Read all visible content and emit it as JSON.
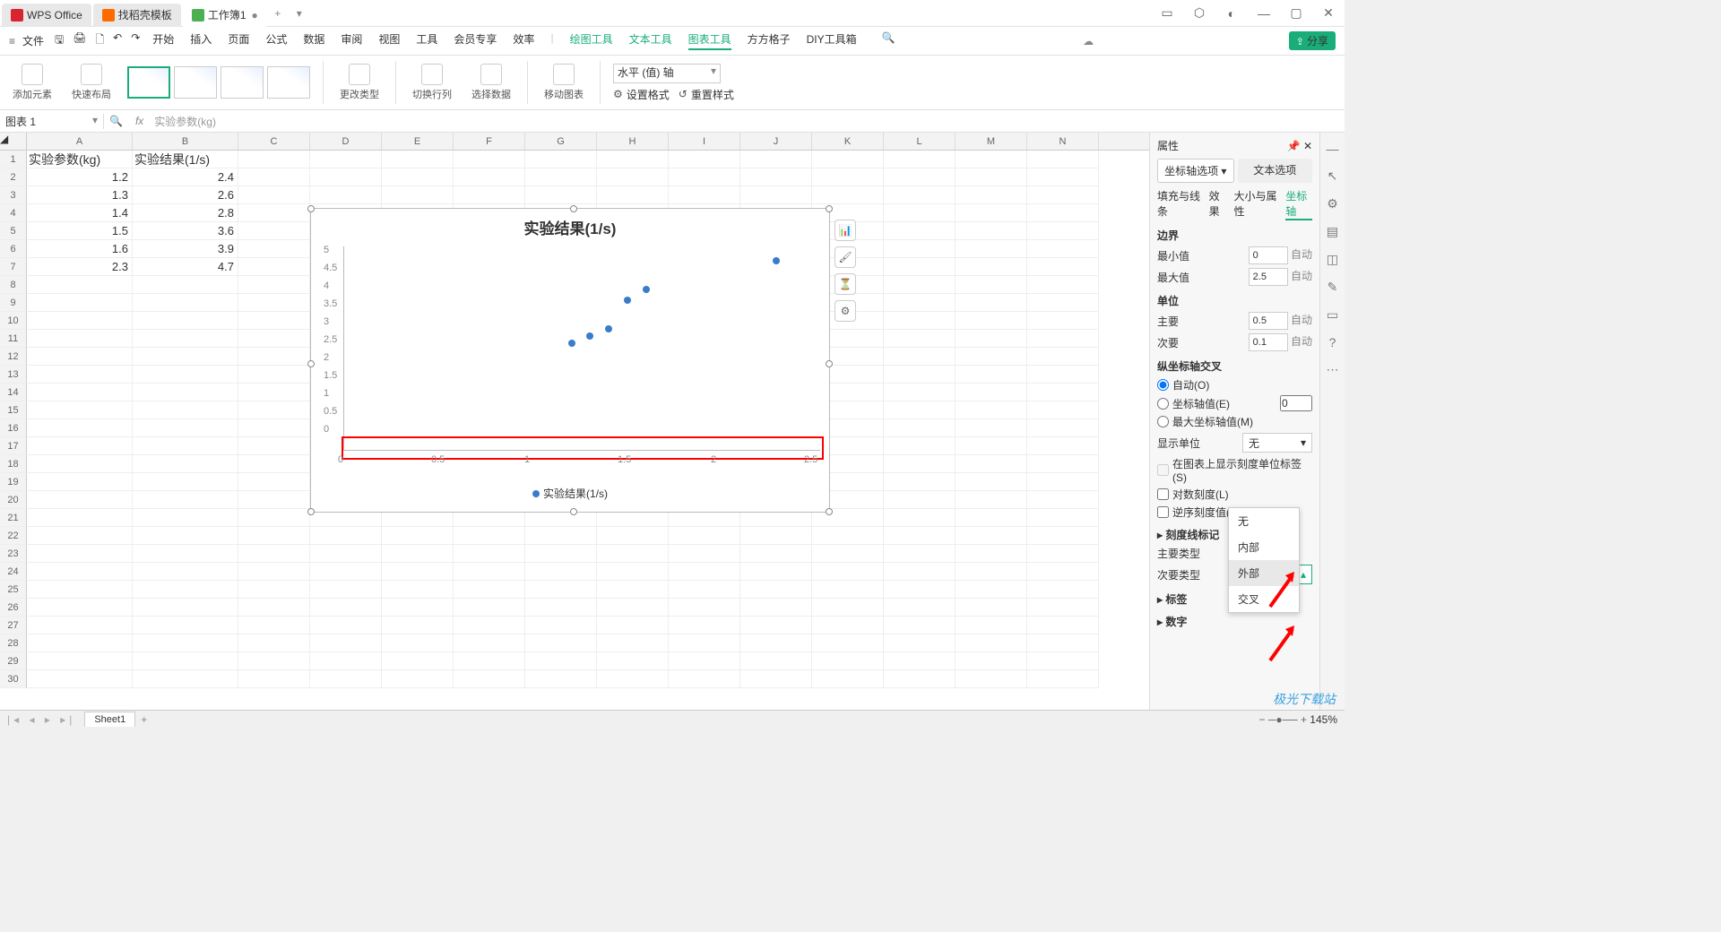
{
  "title_tabs": [
    {
      "icon": "wps",
      "label": "WPS Office"
    },
    {
      "icon": "orange",
      "label": "找稻壳模板"
    },
    {
      "icon": "green",
      "label": "工作簿1",
      "active": true
    }
  ],
  "menu": {
    "file": "文件",
    "tabs": [
      "开始",
      "插入",
      "页面",
      "公式",
      "数据",
      "审阅",
      "视图",
      "工具",
      "会员专享",
      "效率"
    ],
    "green_tabs": [
      "绘图工具",
      "文本工具",
      "图表工具",
      "方方格子",
      "DIY工具箱"
    ],
    "active": "图表工具",
    "share": "分享"
  },
  "toolbar": {
    "add_element": "添加元素",
    "quick_layout": "快速布局",
    "change_type": "更改类型",
    "switch_rc": "切换行列",
    "select_data": "选择数据",
    "move_chart": "移动图表",
    "axis_select": "水平 (值) 轴",
    "set_format": "设置格式",
    "reset_style": "重置样式"
  },
  "fx": {
    "name": "图表 1",
    "formula": "实验参数(kg)"
  },
  "columns": [
    "A",
    "B",
    "C",
    "D",
    "E",
    "F",
    "G",
    "H",
    "I",
    "J",
    "K",
    "L",
    "M",
    "N"
  ],
  "sheet_data": {
    "headers": [
      "实验参数(kg)",
      "实验结果(1/s)"
    ],
    "rows": [
      [
        1.2,
        2.4
      ],
      [
        1.3,
        2.6
      ],
      [
        1.4,
        2.8
      ],
      [
        1.5,
        3.6
      ],
      [
        1.6,
        3.9
      ],
      [
        2.3,
        4.7
      ]
    ]
  },
  "chart_data": {
    "type": "scatter",
    "title": "实验结果(1/s)",
    "x": [
      1.2,
      1.3,
      1.4,
      1.5,
      1.6,
      2.3
    ],
    "y": [
      2.4,
      2.6,
      2.8,
      3.6,
      3.9,
      4.7
    ],
    "series": [
      {
        "name": "实验结果(1/s)",
        "x": [
          1.2,
          1.3,
          1.4,
          1.5,
          1.6,
          2.3
        ],
        "y": [
          2.4,
          2.6,
          2.8,
          3.6,
          3.9,
          4.7
        ]
      }
    ],
    "xlim": [
      0,
      2.5
    ],
    "ylim": [
      0,
      5
    ],
    "x_major": 0.5,
    "y_major": 0.5,
    "legend": "实验结果(1/s)"
  },
  "prop": {
    "title": "属性",
    "tab1": "坐标轴选项",
    "tab2": "文本选项",
    "sub": [
      "填充与线条",
      "效果",
      "大小与属性",
      "坐标轴"
    ],
    "boundary": "边界",
    "min": "最小值",
    "min_val": "0",
    "max": "最大值",
    "max_val": "2.5",
    "auto": "自动",
    "unit": "单位",
    "major": "主要",
    "major_val": "0.5",
    "minor": "次要",
    "minor_val": "0.1",
    "cross": "纵坐标轴交叉",
    "auto_o": "自动(O)",
    "axis_e": "坐标轴值(E)",
    "axis_e_val": "0",
    "max_m": "最大坐标轴值(M)",
    "disp_unit": "显示单位",
    "none": "无",
    "show_label": "在图表上显示刻度单位标签(S)",
    "log": "对数刻度(L)",
    "rev": "逆序刻度值(V)",
    "ticks": "刻度线标记",
    "major_type": "主要类型",
    "minor_type": "次要类型",
    "minor_type_val": "外部",
    "labels": "标签",
    "number": "数字",
    "dropdown": [
      "无",
      "内部",
      "外部",
      "交叉"
    ]
  },
  "sheet_tab": "Sheet1",
  "zoom": "145%",
  "watermark": "极光下载站"
}
